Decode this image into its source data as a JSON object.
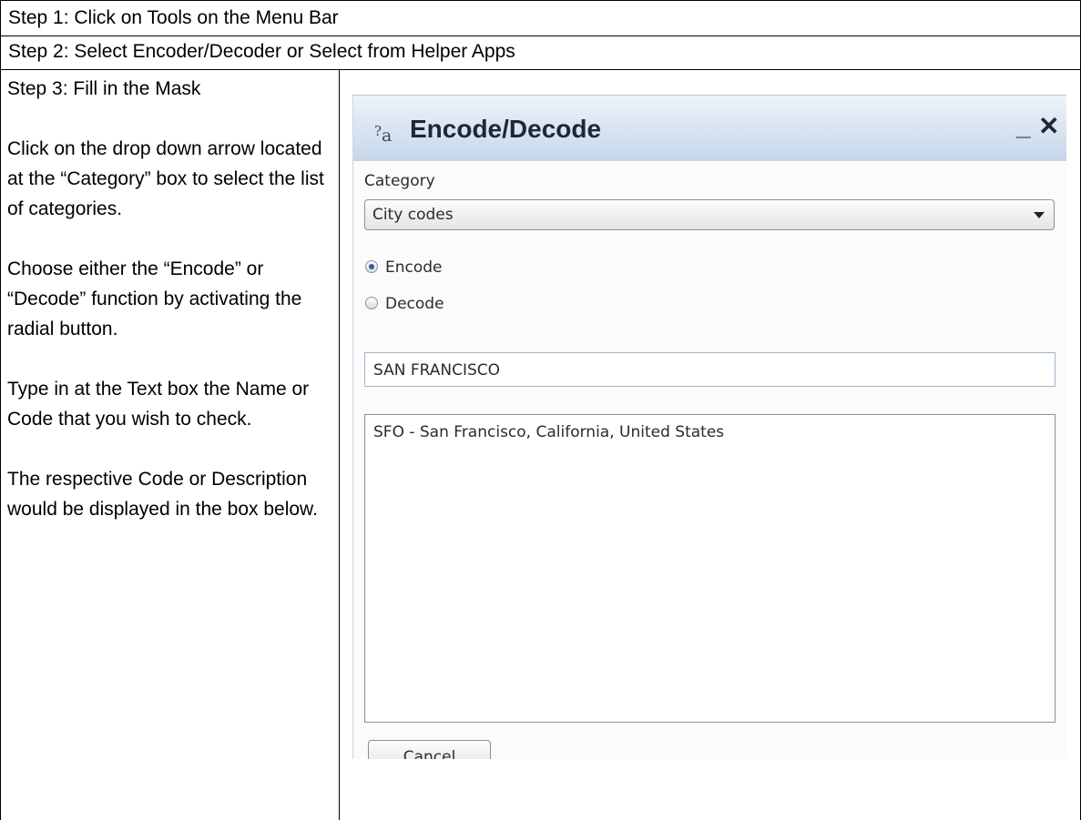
{
  "steps": {
    "step1": "Step 1: Click on Tools on the Menu Bar",
    "step2": "Step 2: Select  Encoder/Decoder or Select from Helper Apps",
    "step3_title": "Step 3: Fill in the Mask"
  },
  "instructions": [
    "Click on the drop down arrow located at the “Category” box to select the list of categories.",
    "Choose either the “Encode” or “Decode” function by activating the radial button.",
    "Type in at the Text box the Name or Code that you wish to check.",
    "The respective Code or Description would be displayed in the box below."
  ],
  "dialog": {
    "icon": "encode-decode-icon",
    "title": "Encode/Decode",
    "minimize_label": "_",
    "close_label": "✕",
    "category_label": "Category",
    "category_value": "City codes",
    "radio_encode": "Encode",
    "radio_decode": "Decode",
    "selected_mode": "Encode",
    "text_value": "SAN FRANCISCO",
    "result_line": "SFO - San Francisco, California, United States",
    "cancel_label": "Cancel"
  }
}
